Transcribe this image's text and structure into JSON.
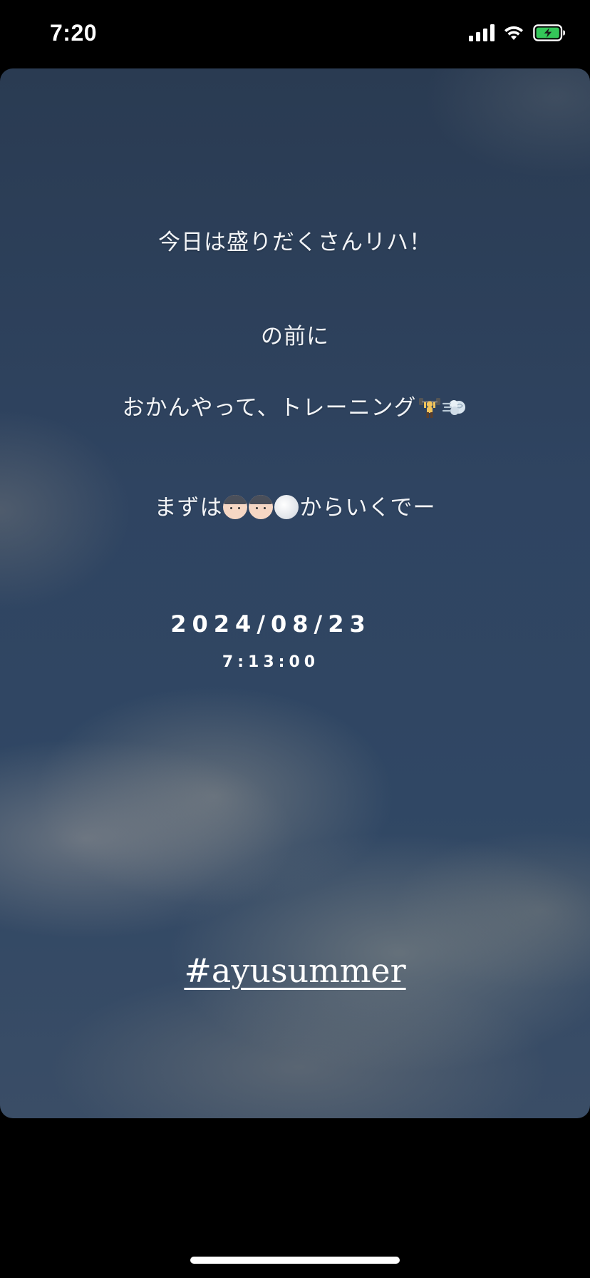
{
  "status_bar": {
    "time": "7:20",
    "icons": [
      "signal-icon",
      "wifi-icon",
      "battery-charging-icon"
    ],
    "battery_color": "#34c759"
  },
  "story": {
    "lines": [
      "今日は盛りだくさんリハ！",
      "の前に",
      "おかんやって、トレーニング",
      "まずは",
      "からいくでー"
    ],
    "emojis": {
      "line3": [
        "weightlifter-emoji",
        "dash-emoji"
      ],
      "line4": [
        "boy-emoji",
        "boy-emoji",
        "rice-emoji"
      ]
    },
    "date": "2024/08/23",
    "time": "7:13:00",
    "hashtag": "#ayusummer",
    "sky_color": "#2f4461"
  }
}
